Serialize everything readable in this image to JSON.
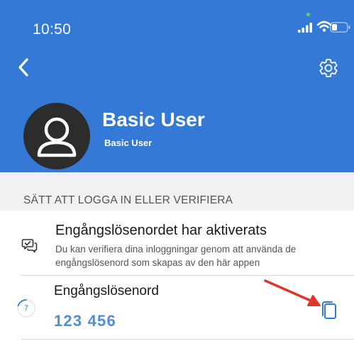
{
  "status_bar": {
    "time": "10:50"
  },
  "header": {
    "back_icon": "chevron-left-icon",
    "settings_icon": "gear-icon",
    "color": "#3579d6"
  },
  "profile": {
    "avatar_icon": "user-avatar-icon",
    "name": "Basic User",
    "subname": "Basic User"
  },
  "section": {
    "title": "SÄTT ATT LOGGA IN ELLER VERIFIERA"
  },
  "otp_activated": {
    "icon": "verify-chat-icon",
    "title": "Engångslösenordet har aktiverats",
    "description": "Du kan verifiera dina inloggningar genom att använda de engångslösenord som skapas av den här appen"
  },
  "otp": {
    "label": "Engångslösenord",
    "timer_seconds": "7",
    "code": "123 456",
    "copy_icon": "copy-icon",
    "annotation_icon": "red-arrow-icon",
    "code_color": "#4e8ed8"
  }
}
